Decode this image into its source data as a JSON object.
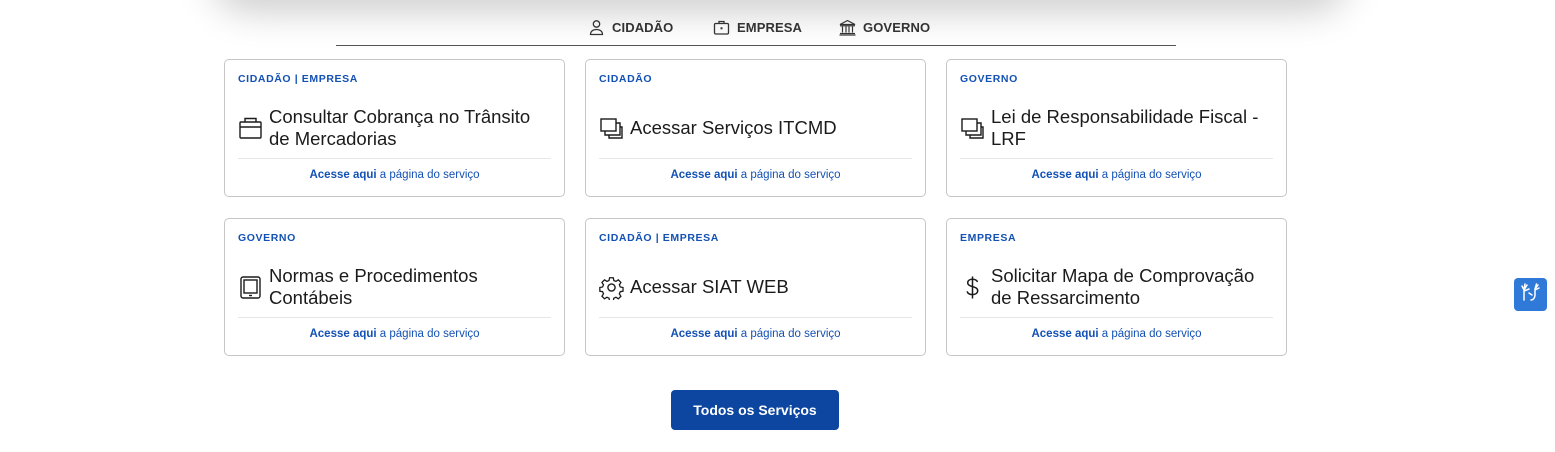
{
  "tabs": [
    {
      "label": "CIDADÃO",
      "icon": "person-icon"
    },
    {
      "label": "EMPRESA",
      "icon": "briefcase-icon"
    },
    {
      "label": "GOVERNO",
      "icon": "government-building-icon"
    }
  ],
  "cards": [
    {
      "tag": "CIDADÃO | EMPRESA",
      "title": "Consultar Cobrança no Trânsito de Mercadorias",
      "icon": "cash-register-icon",
      "link_bold": "Acesse aqui",
      "link_rest": " a página do serviço"
    },
    {
      "tag": "CIDADÃO",
      "title": "Acessar Serviços ITCMD",
      "icon": "windows-icon",
      "link_bold": "Acesse aqui",
      "link_rest": " a página do serviço"
    },
    {
      "tag": "GOVERNO",
      "title": "Lei de Responsabilidade Fiscal - LRF",
      "icon": "windows-icon",
      "link_bold": "Acesse aqui",
      "link_rest": " a página do serviço"
    },
    {
      "tag": "GOVERNO",
      "title": "Normas e Procedimentos Contábeis",
      "icon": "tablet-icon",
      "link_bold": "Acesse aqui",
      "link_rest": " a página do serviço"
    },
    {
      "tag": "CIDADÃO | EMPRESA",
      "title": "Acessar SIAT WEB",
      "icon": "gear-icon",
      "link_bold": "Acesse aqui",
      "link_rest": " a página do serviço"
    },
    {
      "tag": "EMPRESA",
      "title": "Solicitar Mapa de Comprovação de Ressarcimento",
      "icon": "dollar-icon",
      "link_bold": "Acesse aqui",
      "link_rest": " a página do serviço"
    }
  ],
  "all_services_button": "Todos os Serviços",
  "accessibility_widget": {
    "icon": "sign-language-hands-icon"
  },
  "colors": {
    "accent": "#1351b4",
    "button": "#0c46a0",
    "widget": "#2f7ad9"
  }
}
